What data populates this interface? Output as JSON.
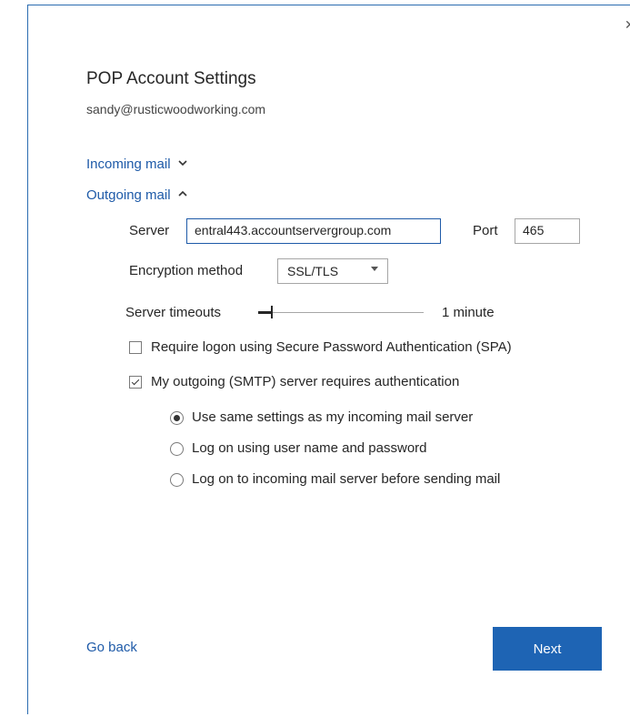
{
  "window": {
    "close_glyph": "✕"
  },
  "header": {
    "title": "POP Account Settings",
    "email": "sandy@rusticwoodworking.com"
  },
  "sections": {
    "incoming_label": "Incoming mail",
    "outgoing_label": "Outgoing mail"
  },
  "outgoing": {
    "server_label": "Server",
    "server_value": "entral443.accountservergroup.com",
    "port_label": "Port",
    "port_value": "465",
    "encryption_label": "Encryption method",
    "encryption_value": "SSL/TLS",
    "timeout_label": "Server timeouts",
    "timeout_value": "1 minute",
    "spa_label": "Require logon using Secure Password Authentication (SPA)",
    "spa_checked": false,
    "auth_label": "My outgoing (SMTP) server requires authentication",
    "auth_checked": true,
    "auth_options": [
      {
        "label": "Use same settings as my incoming mail server",
        "selected": true
      },
      {
        "label": "Log on using user name and password",
        "selected": false
      },
      {
        "label": "Log on to incoming mail server before sending mail",
        "selected": false
      }
    ]
  },
  "footer": {
    "back_label": "Go back",
    "next_label": "Next"
  },
  "colors": {
    "accent": "#1e64b4",
    "link": "#1e5aa8"
  }
}
